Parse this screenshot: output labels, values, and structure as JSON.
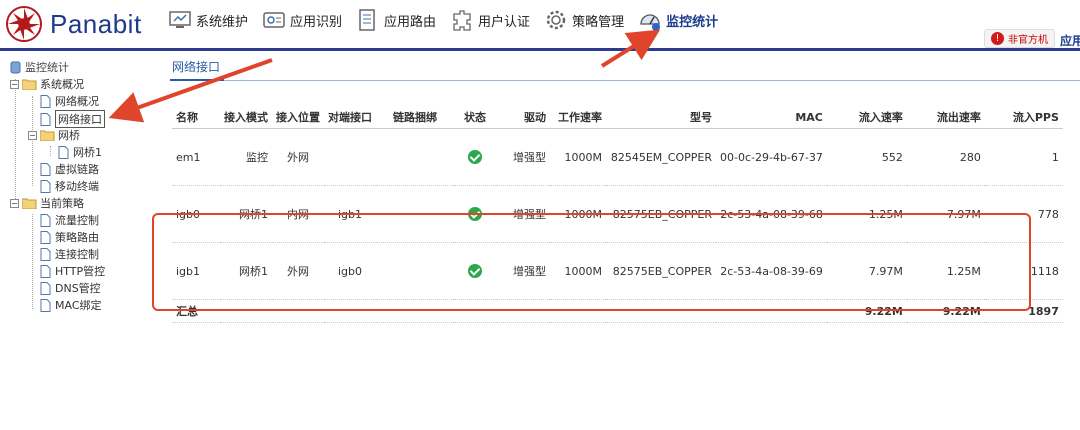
{
  "app": {
    "brand": "Panabit"
  },
  "menu": [
    {
      "label": "系统维护",
      "icon": "system-maintenance-icon"
    },
    {
      "label": "应用识别",
      "icon": "app-identify-icon"
    },
    {
      "label": "应用路由",
      "icon": "app-routing-icon"
    },
    {
      "label": "用户认证",
      "icon": "user-auth-icon"
    },
    {
      "label": "策略管理",
      "icon": "gear-icon"
    },
    {
      "label": "监控统计",
      "icon": "monitor-icon",
      "active": true
    }
  ],
  "header_right": {
    "badge": "非官方机",
    "cut_text": "应用"
  },
  "sidebar": {
    "root": "监控统计",
    "groups": [
      {
        "label": "系统概况",
        "items": [
          "网络概况",
          "网络接口"
        ],
        "subgroup": {
          "label": "网桥",
          "items": [
            "网桥1"
          ]
        },
        "items_after": [
          "虚拟链路",
          "移动终端"
        ]
      },
      {
        "label": "当前策略",
        "items": [
          "流量控制",
          "策略路由",
          "连接控制",
          "HTTP管控",
          "DNS管控",
          "MAC绑定"
        ]
      }
    ],
    "selected": "网络接口"
  },
  "tab": {
    "label": "网络接口"
  },
  "table": {
    "headers": [
      "名称",
      "接入模式",
      "接入位置",
      "对端接口",
      "链路捆绑",
      "状态",
      "驱动",
      "工作速率",
      "型号",
      "MAC",
      "流入速率",
      "流出速率",
      "流入PPS"
    ],
    "rows": [
      [
        "em1",
        "监控",
        "外网",
        "",
        "",
        "ok",
        "增强型",
        "1000M",
        "82545EM_COPPER",
        "00-0c-29-4b-67-37",
        "552",
        "280",
        "1"
      ],
      [
        "igb0",
        "网桥1",
        "内网",
        "igb1",
        "",
        "ok",
        "增强型",
        "1000M",
        "82575EB_COPPER",
        "2c-53-4a-08-39-68",
        "1.25M",
        "7.97M",
        "778"
      ],
      [
        "igb1",
        "网桥1",
        "外网",
        "igb0",
        "",
        "ok",
        "增强型",
        "1000M",
        "82575EB_COPPER",
        "2c-53-4a-08-39-69",
        "7.97M",
        "1.25M",
        "1118"
      ]
    ],
    "summary": {
      "label": "汇总",
      "in_rate": "9.22M",
      "out_rate": "9.22M",
      "pps": "1897"
    }
  },
  "colors": {
    "brand": "#1f3a8a",
    "accent": "#2c3b8c",
    "annotation": "#e0452c",
    "status_ok": "#2aa84a"
  }
}
